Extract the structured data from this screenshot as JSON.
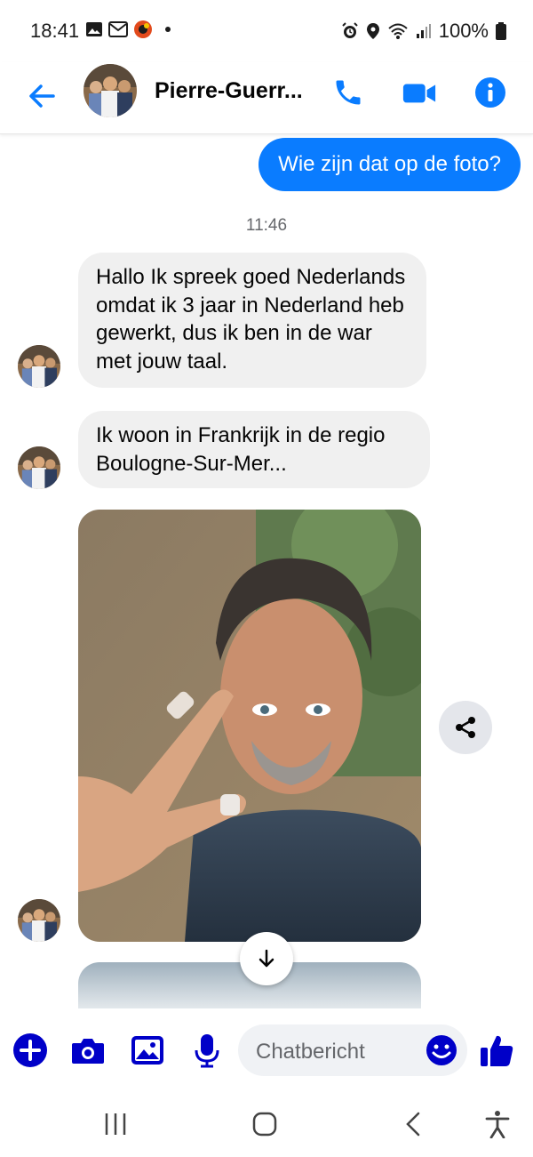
{
  "status_bar": {
    "time": "18:41",
    "battery": "100%",
    "notification_icons": [
      "gallery-icon",
      "gmail-icon",
      "app-icon",
      "dot"
    ],
    "system_icons": [
      "alarm-icon",
      "location-icon",
      "wifi-icon",
      "signal-icon",
      "battery-icon"
    ]
  },
  "header": {
    "contact_name": "Pierre-Guerr...",
    "back_icon": "arrow-left-icon",
    "actions": [
      "phone-icon",
      "video-camera-icon",
      "info-icon"
    ]
  },
  "messages": {
    "outgoing_1": "Wie zijn dat op de foto?",
    "timestamp": "11:46",
    "incoming_1": "Hallo Ik spreek goed Nederlands omdat ik 3 jaar in Nederland heb gewerkt, dus ik ben in de war met jouw taal.",
    "incoming_2": "Ik woon in Frankrijk in de regio Boulogne-Sur-Mer..."
  },
  "composer": {
    "placeholder": "Chatbericht",
    "actions": [
      "plus-icon",
      "camera-icon",
      "gallery-icon",
      "microphone-icon",
      "emoji-icon",
      "thumbs-up-icon"
    ]
  },
  "colors": {
    "accent": "#0a7cff",
    "header_icon": "#0a7cff",
    "composer_icon": "#0000c8",
    "incoming_bubble": "#f0f0f0"
  }
}
